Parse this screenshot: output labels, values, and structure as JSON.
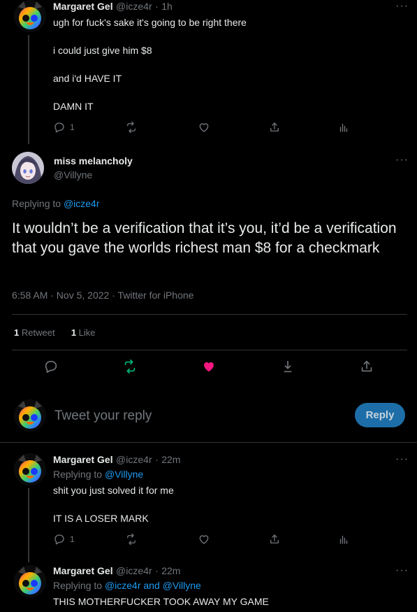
{
  "tweet1": {
    "author": "Margaret Gel",
    "handle": "@icze4r",
    "time": "1h",
    "lines": [
      "ugh for fuck's sake it's going to be right there",
      "i could just give him $8",
      "and i'd HAVE IT",
      "DAMN IT"
    ],
    "reply_count": "1"
  },
  "main_tweet": {
    "author": "miss melancholy",
    "handle": "@Villyne",
    "replying_prefix": "Replying to",
    "replying_to": "@icze4r",
    "text": "It wouldn’t be a verification that it’s you, it’d be a verification that you gave the worlds richest man $8 for a checkmark",
    "timestamp": "6:58 AM · Nov 5, 2022 · Twitter for iPhone",
    "retweet_count": "1",
    "retweet_label": "Retweet",
    "like_count": "1",
    "like_label": "Like"
  },
  "composer": {
    "placeholder": "Tweet your reply",
    "button": "Reply"
  },
  "tweet2": {
    "author": "Margaret Gel",
    "handle": "@icze4r",
    "time": "22m",
    "replying_prefix": "Replying to",
    "replying_to": "@Villyne",
    "lines": [
      "shit you just solved it for me",
      "IT IS A LOSER MARK"
    ],
    "reply_count": "1"
  },
  "tweet3": {
    "author": "Margaret Gel",
    "handle": "@icze4r",
    "time": "22m",
    "replying_prefix": "Replying to",
    "replying_to_1": "@icze4r",
    "replying_and": "and",
    "replying_to_2": "@Villyne",
    "text": "THIS MOTHERFUCKER TOOK AWAY MY GAME"
  },
  "colors": {
    "background": "#000000",
    "accent": "#1d9bf0",
    "retweet_green": "#00ba7c",
    "like_pink": "#f91880"
  },
  "icons": [
    "reply-icon",
    "retweet-icon",
    "like-icon",
    "share-icon",
    "analytics-icon",
    "bookmark-icon",
    "more-icon"
  ]
}
